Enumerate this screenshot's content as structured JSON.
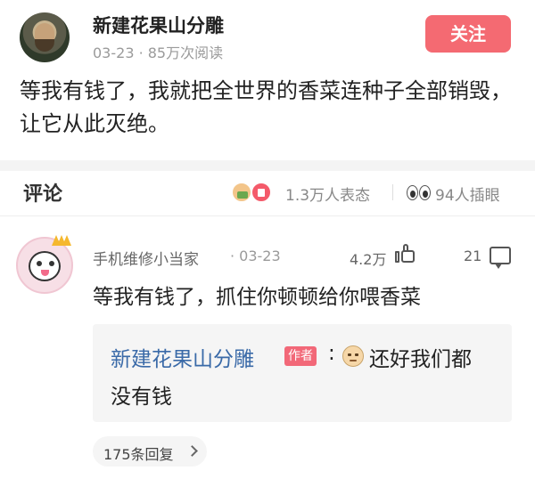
{
  "post": {
    "author": "新建花果山分雕",
    "meta": "03-23 · 85万次阅读",
    "follow_label": "关注",
    "text": "等我有钱了，我就把全世界的香菜连种子全部销毁，让它从此灭绝。"
  },
  "comments_header": {
    "title": "评论",
    "reactions": "1.3万人表态",
    "views": "94人插眼"
  },
  "comment": {
    "user": "手机维修小当家",
    "time": "· 03-23",
    "likes": "4.2万",
    "replies": "21",
    "text": "等我有钱了，抓住你顿顿给你喂香菜",
    "reply": {
      "author": "新建花果山分雕",
      "author_tag": "作者",
      "colon": ":",
      "text_line1": "还好我们都",
      "text_line2": "没有钱"
    },
    "replies_label": "175条回复"
  },
  "colors": {
    "follow_button": "#f46a72",
    "author_link": "#3a6aa8",
    "author_tag": "#f26878"
  },
  "icons": [
    "avatar",
    "crown-icon",
    "thumbs-up-icon",
    "heart-icon",
    "eye-icon",
    "like-icon",
    "reply-icon",
    "emoji-icon",
    "chevron-right-icon"
  ]
}
